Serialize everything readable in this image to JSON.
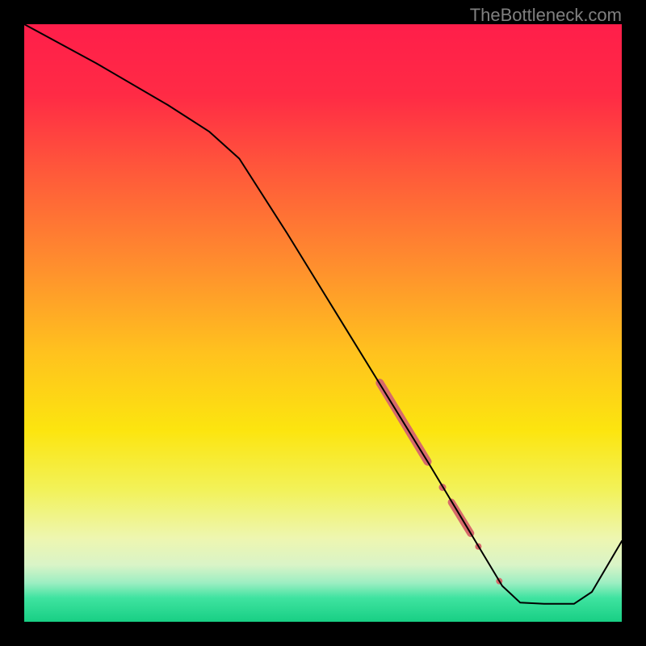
{
  "watermark": "TheBottleneck.com",
  "chart_data": {
    "type": "line",
    "title": "",
    "xlabel": "",
    "ylabel": "",
    "xlim": [
      0,
      100
    ],
    "ylim": [
      0,
      100
    ],
    "gradient_stops": [
      {
        "pos": 0.0,
        "color": "#ff1e4a"
      },
      {
        "pos": 0.12,
        "color": "#ff2b45"
      },
      {
        "pos": 0.25,
        "color": "#ff5a3a"
      },
      {
        "pos": 0.4,
        "color": "#ff8d2e"
      },
      {
        "pos": 0.55,
        "color": "#ffc21e"
      },
      {
        "pos": 0.68,
        "color": "#fce50f"
      },
      {
        "pos": 0.78,
        "color": "#f2f25a"
      },
      {
        "pos": 0.86,
        "color": "#eef6b0"
      },
      {
        "pos": 0.905,
        "color": "#d9f4c7"
      },
      {
        "pos": 0.935,
        "color": "#9ceec2"
      },
      {
        "pos": 0.96,
        "color": "#3fe3a0"
      },
      {
        "pos": 1.0,
        "color": "#18cf84"
      }
    ],
    "series": [
      {
        "name": "bottleneck-curve",
        "color": "#000000",
        "width": 2,
        "points": [
          {
            "x": 0.0,
            "y": 100.0
          },
          {
            "x": 12.0,
            "y": 93.5
          },
          {
            "x": 24.0,
            "y": 86.5
          },
          {
            "x": 31.0,
            "y": 82.0
          },
          {
            "x": 36.0,
            "y": 77.5
          },
          {
            "x": 44.0,
            "y": 65.0
          },
          {
            "x": 52.0,
            "y": 52.0
          },
          {
            "x": 60.0,
            "y": 39.0
          },
          {
            "x": 68.0,
            "y": 26.0
          },
          {
            "x": 74.0,
            "y": 16.0
          },
          {
            "x": 80.0,
            "y": 6.0
          },
          {
            "x": 83.0,
            "y": 3.2
          },
          {
            "x": 87.0,
            "y": 3.0
          },
          {
            "x": 92.0,
            "y": 3.0
          },
          {
            "x": 95.0,
            "y": 5.0
          },
          {
            "x": 100.0,
            "y": 13.5
          }
        ]
      }
    ],
    "markers": {
      "color": "#d66a6a",
      "segments": [
        {
          "type": "segment",
          "x1": 59.5,
          "y1": 40.0,
          "x2": 67.5,
          "y2": 26.8,
          "width": 10
        },
        {
          "type": "dot",
          "x": 70.0,
          "y": 22.5,
          "r": 4.5
        },
        {
          "type": "segment",
          "x1": 71.5,
          "y1": 20.0,
          "x2": 74.7,
          "y2": 14.8,
          "width": 9
        },
        {
          "type": "dot",
          "x": 76.0,
          "y": 12.6,
          "r": 4.0
        },
        {
          "type": "dot",
          "x": 79.5,
          "y": 6.8,
          "r": 4.0
        }
      ]
    }
  }
}
